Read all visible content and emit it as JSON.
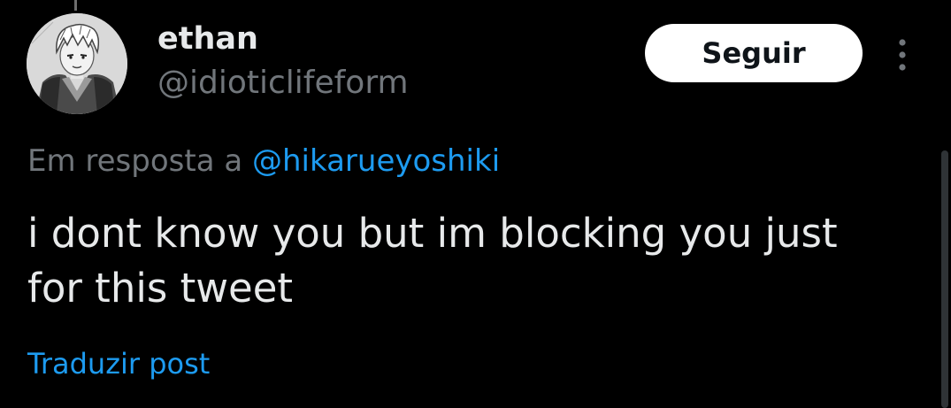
{
  "user": {
    "display_name": "ethan",
    "handle": "@idioticlifeform",
    "avatar_icon": "anime-boy-avatar"
  },
  "actions": {
    "follow_label": "Seguir",
    "more_icon": "vertical-ellipsis-icon"
  },
  "post": {
    "reply_prefix": "Em resposta a",
    "reply_to": "@hikarueyoshiki",
    "text": "i dont know you but im blocking you just for this tweet",
    "translate_label": "Traduzir post"
  },
  "colors": {
    "background": "#000000",
    "primary_text": "#e7e9ea",
    "secondary_text": "#71767b",
    "link": "#1d9bf0",
    "button_bg": "#ffffff",
    "button_text": "#0f1419"
  }
}
